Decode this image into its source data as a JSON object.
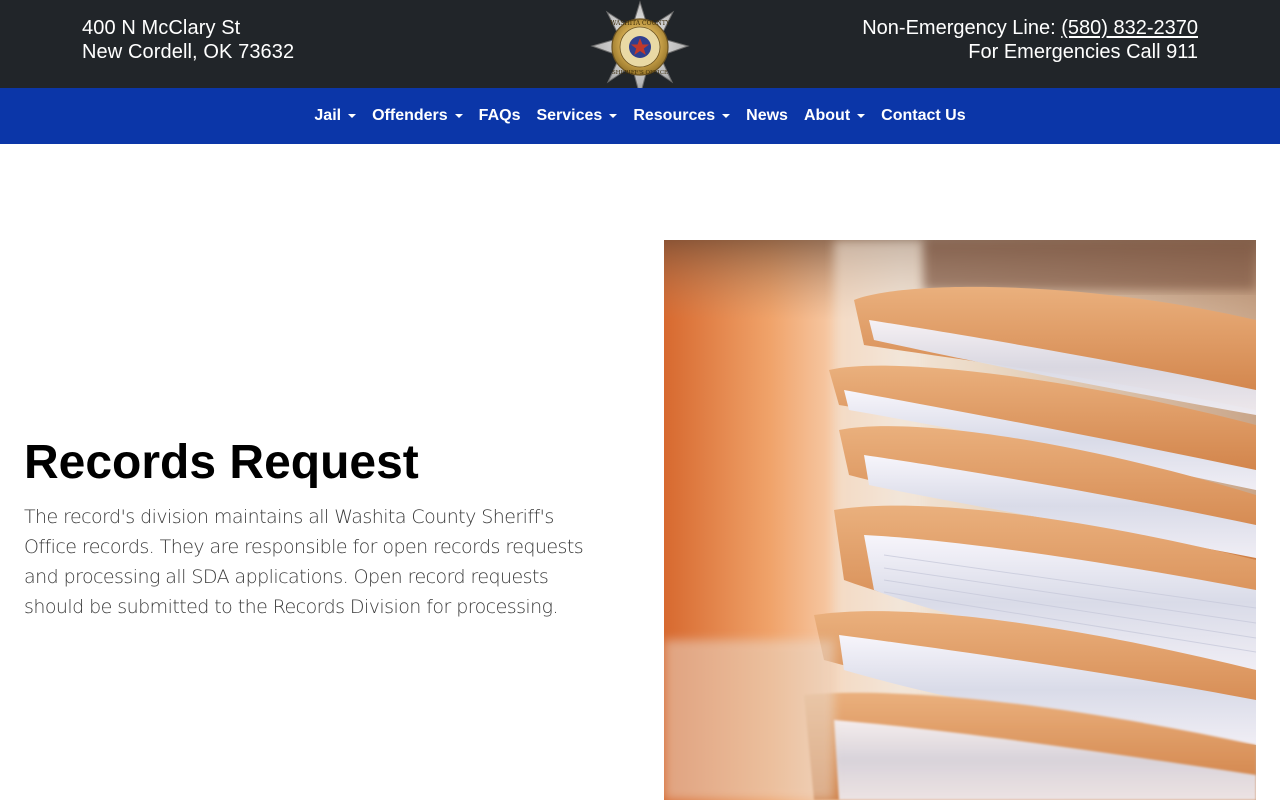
{
  "header": {
    "address_line1": "400 N McClary St",
    "address_line2": "New Cordell, OK 73632",
    "non_emergency_label": "Non-Emergency Line: ",
    "non_emergency_phone": "(580) 832-2370",
    "emergency_text": "For Emergencies Call 911",
    "badge_icon": "sheriff-star-badge-icon",
    "badge_text_top": "WASHITA COUNTY",
    "badge_text_bottom": "SHERIFF'S OFFICE"
  },
  "nav": {
    "items": [
      {
        "label": "Jail",
        "dropdown": true
      },
      {
        "label": "Offenders",
        "dropdown": true
      },
      {
        "label": "FAQs",
        "dropdown": false
      },
      {
        "label": "Services",
        "dropdown": true
      },
      {
        "label": "Resources",
        "dropdown": true
      },
      {
        "label": "News",
        "dropdown": false
      },
      {
        "label": "About",
        "dropdown": true
      },
      {
        "label": "Contact Us",
        "dropdown": false
      }
    ]
  },
  "main": {
    "title": "Records Request",
    "body": "The record's division maintains all Washita County Sheriff's Office records. They are responsible for open records requests and processing all SDA applications. Open record requests should be submitted to the Records Division for processing.",
    "image_subject": "stacked-file-folders-photo"
  },
  "colors": {
    "header_bg": "#212529",
    "nav_bg": "#0b36a8",
    "text_light": "#ffffff",
    "body_text": "#3a3a3a"
  }
}
